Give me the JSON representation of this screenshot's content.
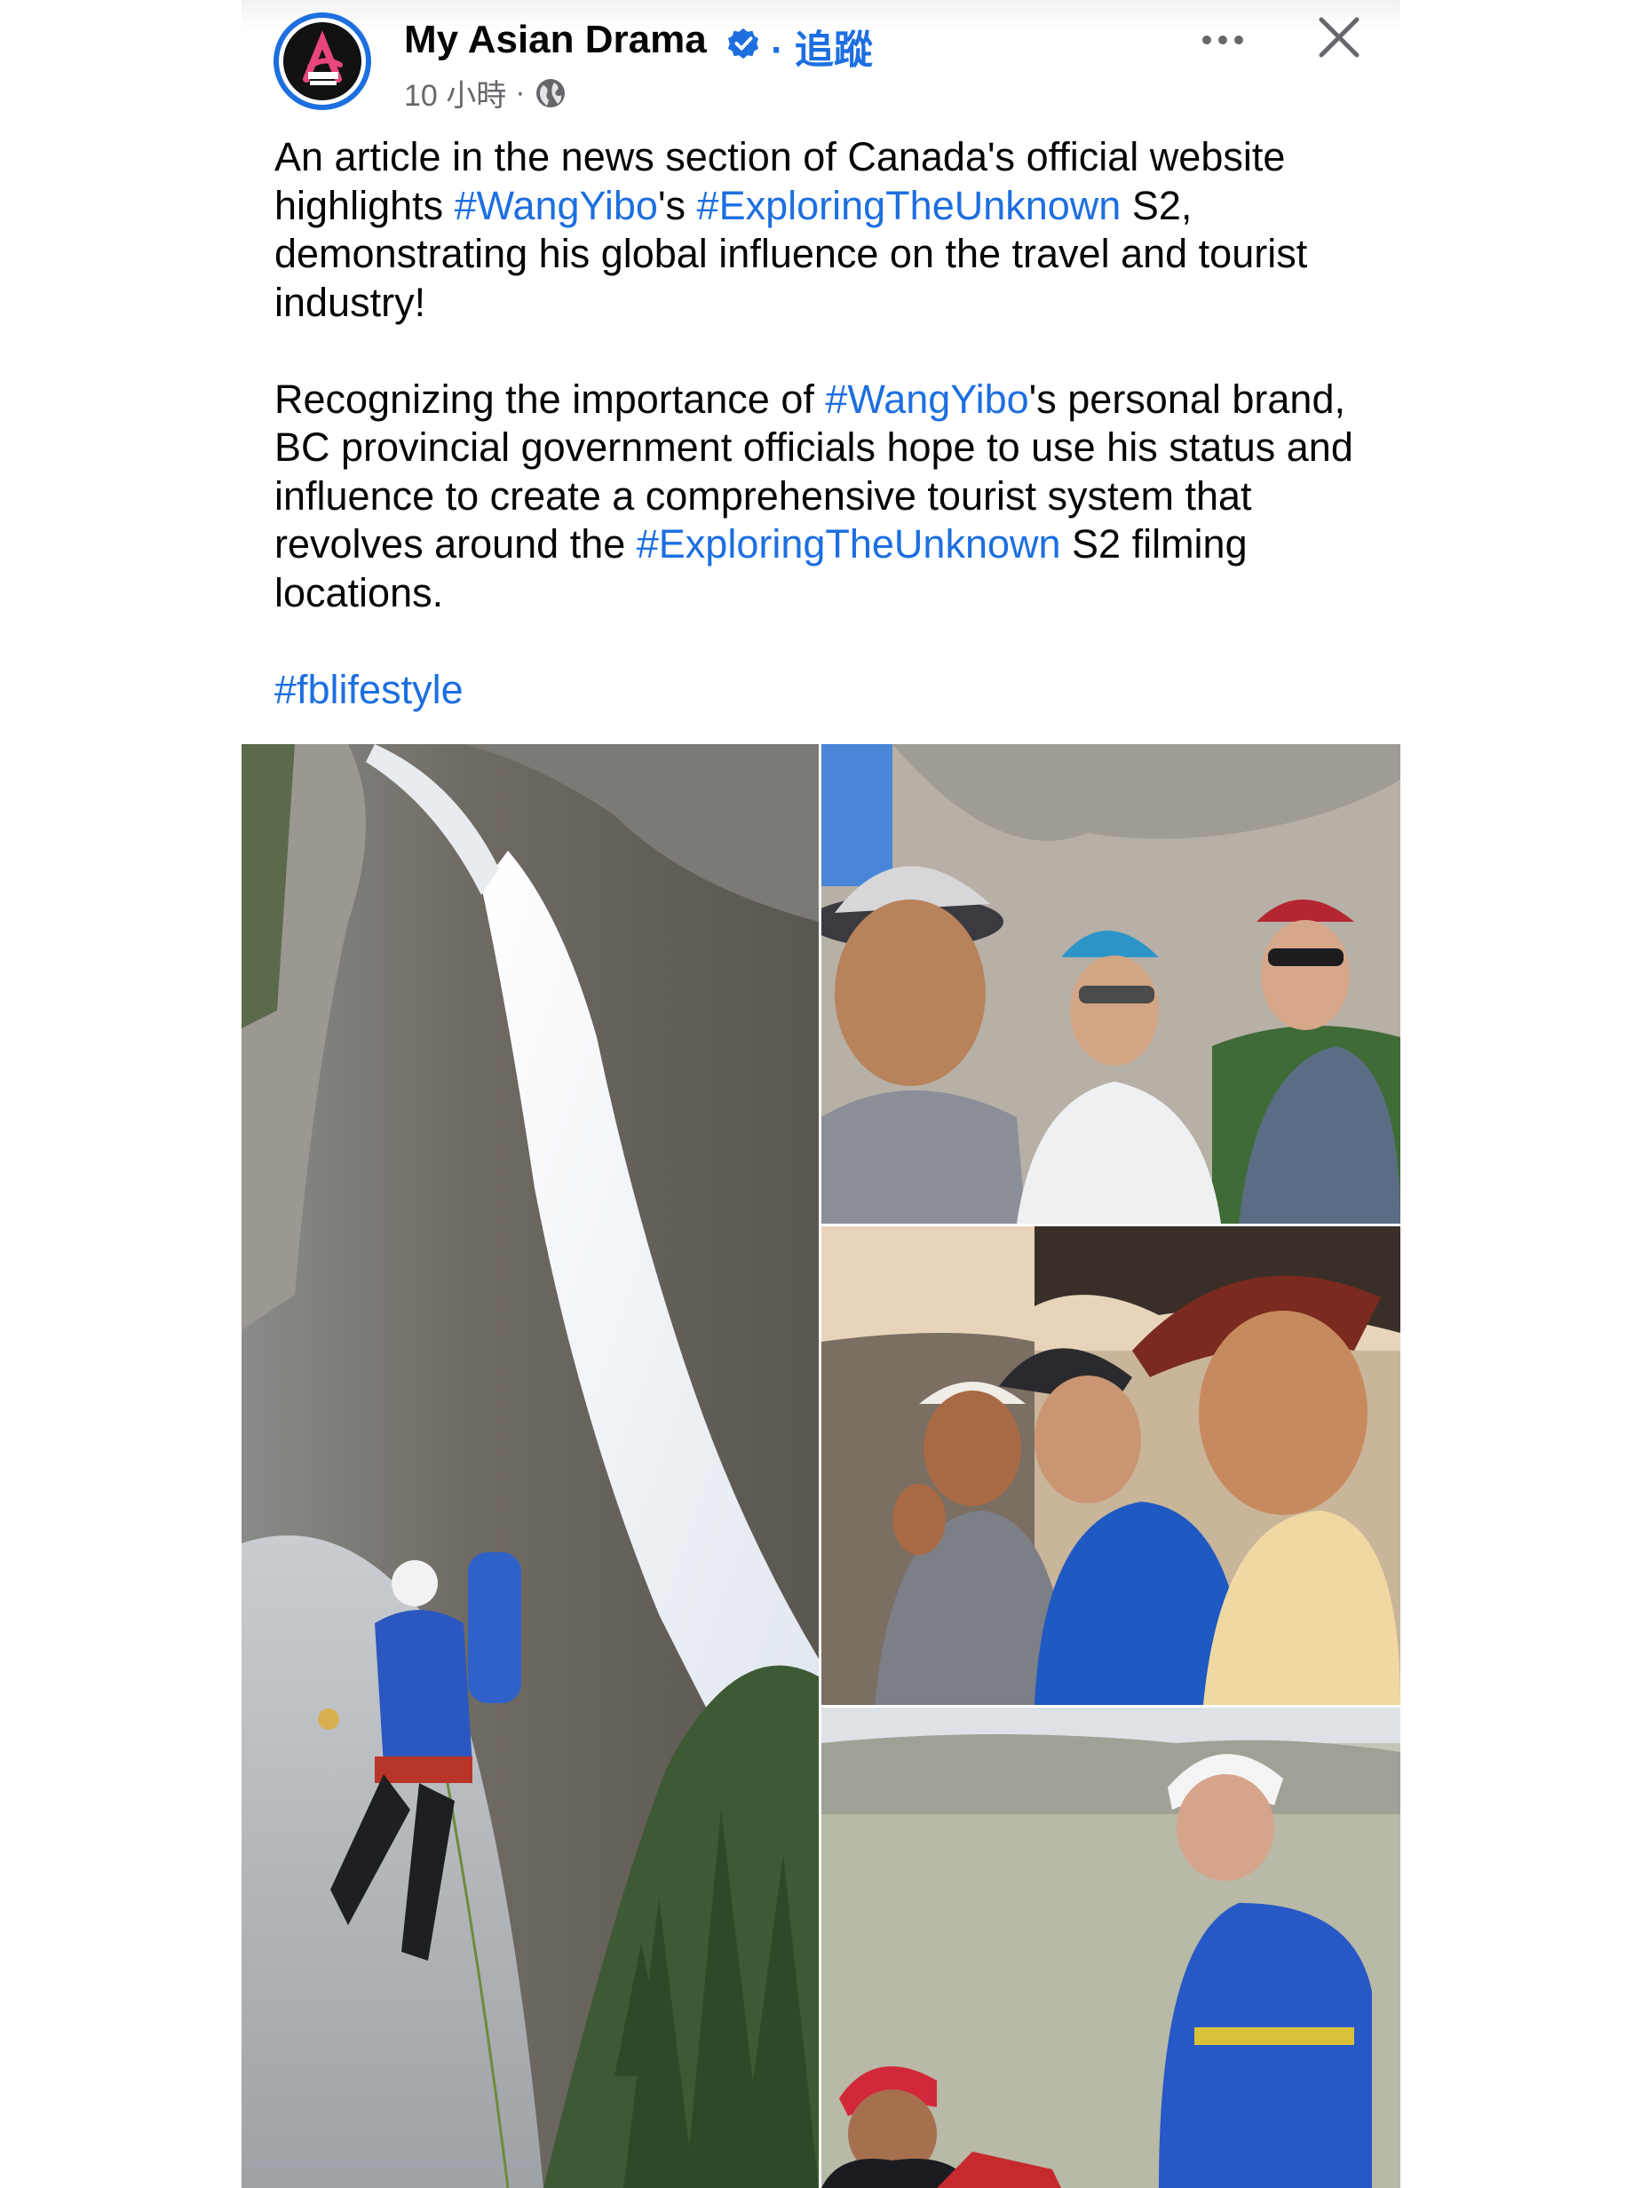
{
  "header": {
    "page_name": "My Asian Drama",
    "follow_label": "追蹤",
    "separator": "·",
    "timestamp": "10 小時",
    "meta_separator": "·",
    "audience_icon": "globe-icon",
    "verified_icon": "verified-badge-icon",
    "more_icon": "more-horizontal-icon",
    "close_icon": "close-icon"
  },
  "post": {
    "p1": [
      {
        "t": "An article in the news section of Canada's official website highlights ",
        "tag": false
      },
      {
        "t": "#WangYibo",
        "tag": true
      },
      {
        "t": "'s ",
        "tag": false
      },
      {
        "t": "#ExploringTheUnknown",
        "tag": true
      },
      {
        "t": " S2, demonstrating his global influence on the travel and tourist industry!",
        "tag": false
      }
    ],
    "p2": [
      {
        "t": "Recognizing the importance of ",
        "tag": false
      },
      {
        "t": "#WangYibo",
        "tag": true
      },
      {
        "t": "'s personal brand, BC provincial government officials hope to use his status and influence to create a comprehensive tourist system that revolves around the ",
        "tag": false
      },
      {
        "t": "#ExploringTheUnknown",
        "tag": true
      },
      {
        "t": " S2 filming locations.",
        "tag": false
      }
    ],
    "p3": [
      {
        "t": "#fblifestyle",
        "tag": true
      }
    ]
  },
  "photos": [
    {
      "name": "waterfall-climber-photo"
    },
    {
      "name": "three-climbers-selfie-photo"
    },
    {
      "name": "climbers-shaka-photo"
    },
    {
      "name": "climbers-summit-photo"
    }
  ],
  "colors": {
    "link": "#1d6fe0",
    "text": "#050505",
    "meta": "#65676b"
  }
}
